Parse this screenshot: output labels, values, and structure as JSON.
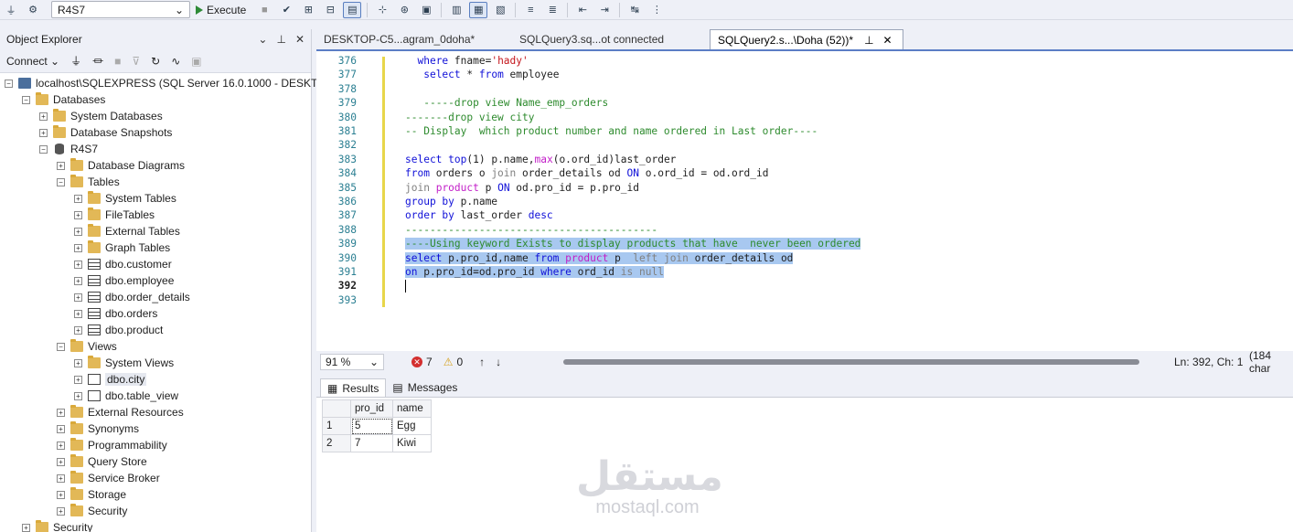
{
  "toolbar": {
    "database": "R4S7",
    "execute_label": "Execute"
  },
  "object_explorer": {
    "title": "Object Explorer",
    "connect_label": "Connect",
    "tree": [
      {
        "label": "localhost\\SQLEXPRESS (SQL Server 16.0.1000 - DESKTOP-",
        "depth": 0,
        "icon": "server-icon",
        "expanded": true
      },
      {
        "label": "Databases",
        "depth": 1,
        "icon": "folder-icon",
        "expanded": true
      },
      {
        "label": "System Databases",
        "depth": 2,
        "icon": "folder-icon",
        "expanded": false
      },
      {
        "label": "Database Snapshots",
        "depth": 2,
        "icon": "folder-icon",
        "expanded": false
      },
      {
        "label": "R4S7",
        "depth": 2,
        "icon": "database-icon",
        "expanded": true
      },
      {
        "label": "Database Diagrams",
        "depth": 3,
        "icon": "folder-icon",
        "expanded": false
      },
      {
        "label": "Tables",
        "depth": 3,
        "icon": "folder-icon",
        "expanded": true
      },
      {
        "label": "System Tables",
        "depth": 4,
        "icon": "folder-icon",
        "expanded": false
      },
      {
        "label": "FileTables",
        "depth": 4,
        "icon": "folder-icon",
        "expanded": false
      },
      {
        "label": "External Tables",
        "depth": 4,
        "icon": "folder-icon",
        "expanded": false
      },
      {
        "label": "Graph Tables",
        "depth": 4,
        "icon": "folder-icon",
        "expanded": false
      },
      {
        "label": "dbo.customer",
        "depth": 4,
        "icon": "table-icon",
        "expanded": false
      },
      {
        "label": "dbo.employee",
        "depth": 4,
        "icon": "table-icon",
        "expanded": false
      },
      {
        "label": "dbo.order_details",
        "depth": 4,
        "icon": "table-icon",
        "expanded": false
      },
      {
        "label": "dbo.orders",
        "depth": 4,
        "icon": "table-icon",
        "expanded": false
      },
      {
        "label": "dbo.product",
        "depth": 4,
        "icon": "table-icon",
        "expanded": false
      },
      {
        "label": "Views",
        "depth": 3,
        "icon": "folder-icon",
        "expanded": true
      },
      {
        "label": "System Views",
        "depth": 4,
        "icon": "folder-icon",
        "expanded": false
      },
      {
        "label": "dbo.city",
        "depth": 4,
        "icon": "view-icon",
        "expanded": false,
        "selected": true
      },
      {
        "label": "dbo.table_view",
        "depth": 4,
        "icon": "view-icon",
        "expanded": false
      },
      {
        "label": "External Resources",
        "depth": 3,
        "icon": "folder-icon",
        "expanded": false
      },
      {
        "label": "Synonyms",
        "depth": 3,
        "icon": "folder-icon",
        "expanded": false
      },
      {
        "label": "Programmability",
        "depth": 3,
        "icon": "folder-icon",
        "expanded": false
      },
      {
        "label": "Query Store",
        "depth": 3,
        "icon": "folder-icon",
        "expanded": false
      },
      {
        "label": "Service Broker",
        "depth": 3,
        "icon": "folder-icon",
        "expanded": false
      },
      {
        "label": "Storage",
        "depth": 3,
        "icon": "folder-icon",
        "expanded": false
      },
      {
        "label": "Security",
        "depth": 3,
        "icon": "folder-icon",
        "expanded": false
      },
      {
        "label": "Security",
        "depth": 1,
        "icon": "folder-icon",
        "expanded": false
      }
    ]
  },
  "tabs": [
    {
      "label": "DESKTOP-C5...agram_0doha*",
      "active": false
    },
    {
      "label": "SQLQuery3.sq...ot connected",
      "active": false
    },
    {
      "label": "SQLQuery2.s...\\Doha (52))*",
      "active": true
    }
  ],
  "editor": {
    "current_line": 392,
    "lines": [
      {
        "n": 376,
        "tokens": [
          [
            "",
            "  "
          ],
          [
            "kw",
            "where"
          ],
          [
            "",
            " fname="
          ],
          [
            "str",
            "'hady'"
          ]
        ]
      },
      {
        "n": 377,
        "tokens": [
          [
            "",
            "   "
          ],
          [
            "kw",
            "select"
          ],
          [
            "",
            " * "
          ],
          [
            "kw",
            "from"
          ],
          [
            "",
            " employee"
          ]
        ]
      },
      {
        "n": 378,
        "tokens": []
      },
      {
        "n": 379,
        "tokens": [
          [
            "",
            "   "
          ],
          [
            "cm",
            "-----drop view Name_emp_orders"
          ]
        ]
      },
      {
        "n": 380,
        "tokens": [
          [
            "cm",
            "-------drop view city"
          ]
        ]
      },
      {
        "n": 381,
        "tokens": [
          [
            "cm",
            "-- Display  which product number and name ordered in Last order----"
          ]
        ]
      },
      {
        "n": 382,
        "tokens": []
      },
      {
        "n": 383,
        "tokens": [
          [
            "kw",
            "select"
          ],
          [
            "",
            " "
          ],
          [
            "kw",
            "top"
          ],
          [
            "",
            "(1) p.name,"
          ],
          [
            "fn",
            "max"
          ],
          [
            "",
            "(o.ord_id)last_order"
          ]
        ]
      },
      {
        "n": 384,
        "tokens": [
          [
            "kw",
            "from"
          ],
          [
            "",
            " orders o "
          ],
          [
            "gr",
            "join"
          ],
          [
            "",
            " order_details od "
          ],
          [
            "kw",
            "ON"
          ],
          [
            "",
            " o.ord_id = od.ord_id"
          ]
        ]
      },
      {
        "n": 385,
        "tokens": [
          [
            "gr",
            "join"
          ],
          [
            "",
            " "
          ],
          [
            "fn",
            "product"
          ],
          [
            "",
            " p "
          ],
          [
            "kw",
            "ON"
          ],
          [
            "",
            " od.pro_id = p.pro_id"
          ]
        ]
      },
      {
        "n": 386,
        "tokens": [
          [
            "kw",
            "group by"
          ],
          [
            "",
            " p.name"
          ]
        ]
      },
      {
        "n": 387,
        "tokens": [
          [
            "kw",
            "order by"
          ],
          [
            "",
            " last_order "
          ],
          [
            "kw",
            "desc"
          ]
        ]
      },
      {
        "n": 388,
        "tokens": [
          [
            "cm",
            "-----------------------------------------"
          ]
        ]
      },
      {
        "n": 389,
        "hl": true,
        "tokens": [
          [
            "cm",
            "----Using keyword Exists to display products that have  never been ordered"
          ]
        ]
      },
      {
        "n": 390,
        "hl": true,
        "tokens": [
          [
            "kw",
            "select"
          ],
          [
            "",
            " p.pro_id,name "
          ],
          [
            "kw",
            "from"
          ],
          [
            "",
            " "
          ],
          [
            "fn",
            "product"
          ],
          [
            "",
            " p  "
          ],
          [
            "gr",
            "left join"
          ],
          [
            "",
            " order_details od"
          ]
        ]
      },
      {
        "n": 391,
        "hl": true,
        "tokens": [
          [
            "kw",
            "on"
          ],
          [
            "",
            " p.pro_id=od.pro_id "
          ],
          [
            "kw",
            "where"
          ],
          [
            "",
            " ord_id "
          ],
          [
            "gr",
            "is null"
          ]
        ]
      },
      {
        "n": 392,
        "tokens": []
      },
      {
        "n": 393,
        "tokens": []
      }
    ]
  },
  "status": {
    "zoom": "91 %",
    "errors": "7",
    "warnings": "0",
    "position": "Ln: 392, Ch: 1",
    "chars": "(184 char"
  },
  "results": {
    "tab_results": "Results",
    "tab_messages": "Messages",
    "columns": [
      "pro_id",
      "name"
    ],
    "rows": [
      {
        "num": "1",
        "pro_id": "5",
        "name": "Egg"
      },
      {
        "num": "2",
        "pro_id": "7",
        "name": "Kiwi"
      }
    ]
  },
  "watermark": {
    "arabic": "مستقل",
    "latin": "mostaql.com"
  }
}
